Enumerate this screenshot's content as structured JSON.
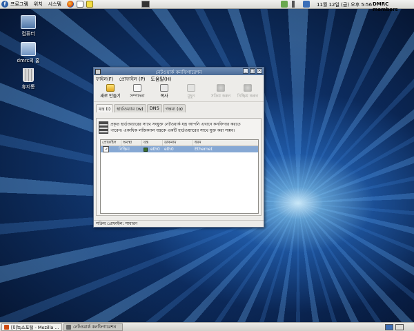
{
  "top_panel": {
    "logo": "f",
    "menus": [
      "프로그램",
      "위치",
      "시스템"
    ],
    "launchers": [
      "firefox-icon",
      "mail-icon",
      "notes-icon"
    ],
    "clock": "11월 12일 (금) 오후 5:56",
    "user": "DMRC members"
  },
  "desktop": {
    "icons": [
      {
        "label": "컴퓨터",
        "icon": "computer-icon"
      },
      {
        "label": "dmrc의 홈",
        "icon": "home-folder-icon"
      },
      {
        "label": "휴지통",
        "icon": "trash-icon"
      }
    ]
  },
  "window": {
    "title": "নেটওয়ার্ক কনফিগারেশন",
    "menu": [
      "ফাইল(F)",
      "প্রোফাইল (P)",
      "도움말(H)"
    ],
    "toolbar": {
      "new": "새로 만들기",
      "edit": "সম্পাদনা",
      "copy": "복사",
      "delete": "মুছুন",
      "activate": "সক্রিয় করুন",
      "deactivate": "নিষ্ক্রিয় করুন"
    },
    "tabs": [
      "যন্ত্র (i)",
      "হার্ডওয়্যার (w)",
      "DNS",
      "গন্তব্য (o)"
    ],
    "info_line1": "প্রকৃত হার্ডওয়্যারের সাথে সংযুক্ত নেটওয়ার্ক যন্ত্র আপনি এখানে কনফিগার করতে",
    "info_line2": "পারেন। একাধিক লজিক্যাল যন্ত্রকে একটি হার্ডওয়্যারের সাথে যুক্ত করা সম্ভব।",
    "columns": [
      "প্রোফাইল",
      "অবস্থা",
      "যন্ত্র",
      "ডাকনাম",
      "ধরন"
    ],
    "rows": [
      {
        "status": "নিষ্ক্রিয়",
        "device": "eth0",
        "nickname": "eth0",
        "type": "Ethernet"
      }
    ],
    "status": "সক্রিয় প্রোফাইল: সাধারণ"
  },
  "bottom_panel": {
    "tasks": [
      "[미녹스포털 - Mozilla ...",
      "নেটওয়ার্ক কনফিগারেশন"
    ]
  }
}
